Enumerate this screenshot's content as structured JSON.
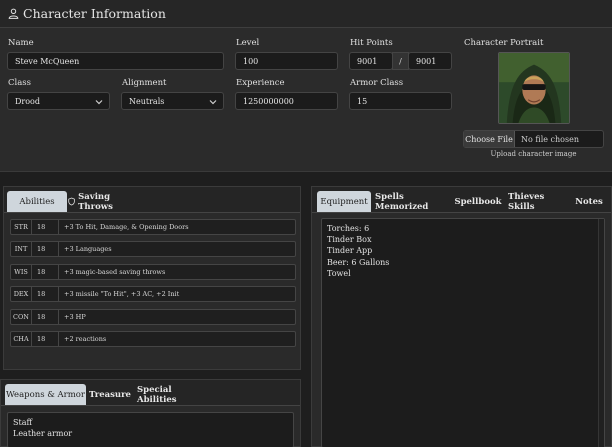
{
  "character": {
    "title": "Character Information",
    "fields": {
      "name": {
        "label": "Name",
        "value": "Steve McQueen"
      },
      "level": {
        "label": "Level",
        "value": "100"
      },
      "hit_points": {
        "label": "Hit Points",
        "current": "9001",
        "separator": "/",
        "max": "9001"
      },
      "class": {
        "label": "Class",
        "value": "Drood"
      },
      "alignment": {
        "label": "Alignment",
        "value": "Neutrals"
      },
      "experience": {
        "label": "Experience",
        "value": "1250000000"
      },
      "armor_class": {
        "label": "Armor Class",
        "value": "15"
      }
    },
    "portrait": {
      "label": "Character Portrait",
      "choose_file": "Choose File",
      "file_status": "No file chosen",
      "upload_label": "Upload character image"
    }
  },
  "abilities_panel": {
    "tabs": [
      {
        "label": "Abilities",
        "active": true,
        "icon": null
      },
      {
        "label": "Saving Throws",
        "active": false,
        "icon": "shield-icon"
      }
    ],
    "rows": [
      {
        "name": "STR",
        "score": "18",
        "desc": "+3 To Hit, Damage, & Opening Doors"
      },
      {
        "name": "INT",
        "score": "18",
        "desc": "+3 Languages"
      },
      {
        "name": "WIS",
        "score": "18",
        "desc": "+3 magic-based saving throws"
      },
      {
        "name": "DEX",
        "score": "18",
        "desc": "+3 missile \"To Hit\", +3 AC, +2 Init"
      },
      {
        "name": "CON",
        "score": "18",
        "desc": "+3 HP"
      },
      {
        "name": "CHA",
        "score": "18",
        "desc": "+2 reactions"
      }
    ]
  },
  "equipment_panel": {
    "tabs": [
      {
        "label": "Equipment",
        "active": true
      },
      {
        "label": "Spells Memorized",
        "active": false
      },
      {
        "label": "Spellbook",
        "active": false
      },
      {
        "label": "Thieves Skills",
        "active": false
      },
      {
        "label": "Notes",
        "active": false
      }
    ],
    "lines": [
      "Torches: 6",
      "Tinder Box",
      "Tinder App",
      "Beer: 6 Gallons",
      "Towel"
    ]
  },
  "weapons_panel": {
    "tabs": [
      {
        "label": "Weapons & Armor",
        "active": true
      },
      {
        "label": "Treasure",
        "active": false
      },
      {
        "label": "Special Abilities",
        "active": false
      }
    ],
    "lines": [
      "Staff",
      "Leather armor"
    ]
  },
  "colors": {
    "background": "#1e1e1e",
    "panel": "#2a2a2a",
    "active_tab": "#cfd6dc",
    "field": "#1b1b1b"
  }
}
